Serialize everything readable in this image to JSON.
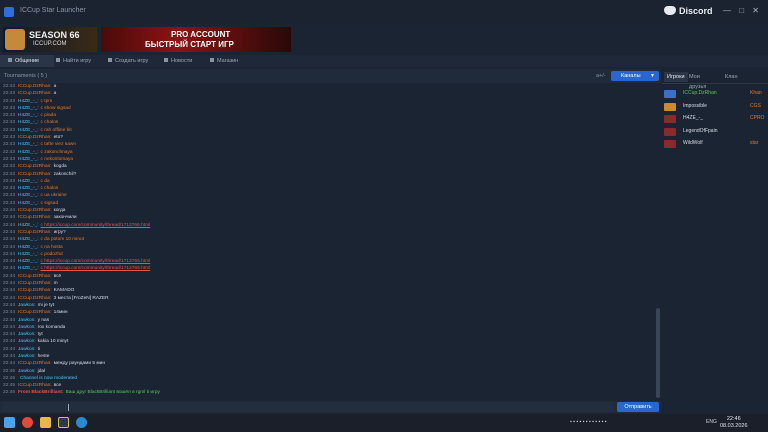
{
  "window": {
    "title": "ICCup Star Launcher",
    "controls": "— □ ✕"
  },
  "discord": {
    "label": "Discord",
    "controls": "— □ ✕"
  },
  "banners": {
    "left": {
      "title": "SEASON 66",
      "site": "ICCUP.COM"
    },
    "right": {
      "line1": "PRO ACCOUNT",
      "line2": "БЫСТРЫЙ СТАРТ ИГР"
    }
  },
  "tabs": [
    "Общение",
    "Найти игру",
    "Создать игру",
    "Новости",
    "Магазин"
  ],
  "chat_header": {
    "channel": "Tournaments ( 5 )",
    "font_toggle": "a+/-",
    "channels_button": "Каналы"
  },
  "messages": [
    {
      "time": "22:43",
      "user": "ICCup.DzRhan:",
      "ucls": "u-orange",
      "text": "a",
      "tcls": "m-white"
    },
    {
      "time": "22:43",
      "user": "ICCup.DzRhan:",
      "ucls": "u-orange",
      "text": "a",
      "tcls": "m-white"
    },
    {
      "time": "22:43",
      "user": "H4ZE_-_:",
      "ucls": "u-cyan",
      "text": "c tpm",
      "tcls": "m-orange"
    },
    {
      "time": "22:43",
      "user": "H4ZE_-_:",
      "ucls": "u-cyan",
      "text": "c show sigsad",
      "tcls": "m-orange"
    },
    {
      "time": "22:43",
      "user": "H4ZE_-_:",
      "ucls": "u-cyan",
      "text": "c piada",
      "tcls": "m-orange"
    },
    {
      "time": "22:43",
      "user": "H4ZE_-_:",
      "ucls": "u-cyan",
      "text": "c chalos",
      "tcls": "m-orange"
    },
    {
      "time": "22:43",
      "user": "H4ZE_-_:",
      "ucls": "u-cyan",
      "text": "c rah offline bit",
      "tcls": "m-orange"
    },
    {
      "time": "22:43",
      "user": "ICCup.DzRhan:",
      "ucls": "u-orange",
      "text": "eto?",
      "tcls": "m-white"
    },
    {
      "time": "22:43",
      "user": "H4ZE_-_:",
      "ucls": "u-cyan",
      "text": "c tafte viez sawn",
      "tcls": "m-orange"
    },
    {
      "time": "22:43",
      "user": "H4ZE_-_:",
      "ucls": "u-cyan",
      "text": "c zakonchnaya",
      "tcls": "m-orange"
    },
    {
      "time": "22:43",
      "user": "H4ZE_-_:",
      "ucls": "u-cyan",
      "text": "c nekontorsaya",
      "tcls": "m-orange"
    },
    {
      "time": "22:43",
      "user": "ICCup.DzRhan:",
      "ucls": "u-orange",
      "text": "kogda",
      "tcls": "m-white"
    },
    {
      "time": "22:43",
      "user": "ICCup.DzRhan:",
      "ucls": "u-orange",
      "text": "zakonchil?",
      "tcls": "m-white"
    },
    {
      "time": "22:43",
      "user": "H4ZE_-_:",
      "ucls": "u-cyan",
      "text": "c da",
      "tcls": "m-orange"
    },
    {
      "time": "22:43",
      "user": "H4ZE_-_:",
      "ucls": "u-cyan",
      "text": "c chalos",
      "tcls": "m-orange"
    },
    {
      "time": "22:43",
      "user": "H4ZE_-_:",
      "ucls": "u-cyan",
      "text": "c ua ukraine",
      "tcls": "m-orange"
    },
    {
      "time": "22:43",
      "user": "H4ZE_-_:",
      "ucls": "u-cyan",
      "text": "c sigsad",
      "tcls": "m-orange"
    },
    {
      "time": "22:44",
      "user": "ICCup.DzRhan:",
      "ucls": "u-orange",
      "text": "когда",
      "tcls": "m-white"
    },
    {
      "time": "22:44",
      "user": "ICCup.DzRhan:",
      "ucls": "u-orange",
      "text": "закончили",
      "tcls": "m-white"
    },
    {
      "time": "22:44",
      "user": "H4ZE_-_:",
      "ucls": "u-cyan",
      "text": "c https://iccup.com/community/thread/1713766.html",
      "tcls": "m-link"
    },
    {
      "time": "22:44",
      "user": "ICCup.DzRhan:",
      "ucls": "u-orange",
      "text": "игру?",
      "tcls": "m-white"
    },
    {
      "time": "22:44",
      "user": "H4ZE_-_:",
      "ucls": "u-cyan",
      "text": "c da potom 10 minut",
      "tcls": "m-orange"
    },
    {
      "time": "22:44",
      "user": "H4ZE_-_:",
      "ucls": "u-cyan",
      "text": "c na hosta",
      "tcls": "m-orange"
    },
    {
      "time": "22:44",
      "user": "H4ZE_-_:",
      "ucls": "u-cyan",
      "text": "c podozhd",
      "tcls": "m-orange"
    },
    {
      "time": "22:44",
      "user": "H4ZE_-_:",
      "ucls": "u-cyan",
      "text": "c https://iccup.com/community/thread/1713766.html",
      "tcls": "m-link"
    },
    {
      "time": "22:44",
      "user": "H4ZE_-_:",
      "ucls": "u-cyan",
      "text": "c https://iccup.com/community/thread/1713766.html",
      "tcls": "m-link"
    },
    {
      "time": "22:44",
      "user": "ICCup.DzRhan:",
      "ucls": "u-orange",
      "text": "всё",
      "tcls": "m-white"
    },
    {
      "time": "22:44",
      "user": "ICCup.DzRhan:",
      "ucls": "u-orange",
      "text": "m",
      "tcls": "m-white"
    },
    {
      "time": "22:44",
      "user": "ICCup.DzRhan:",
      "ucls": "u-orange",
      "text": "KAMADO",
      "tcls": "m-white"
    },
    {
      "time": "22:44",
      "user": "ICCup.DzRhan:",
      "ucls": "u-orange",
      "text": "3 места [FroZeN] RAZER",
      "tcls": "m-white"
    },
    {
      "time": "22:44",
      "user": "Jawkon:",
      "ucls": "u-cyan",
      "text": "mi je tyt",
      "tcls": "m-white"
    },
    {
      "time": "22:44",
      "user": "ICCup.DzRhan:",
      "ucls": "u-orange",
      "text": "14мин",
      "tcls": "m-white"
    },
    {
      "time": "22:44",
      "user": "Jawkon:",
      "ucls": "u-cyan",
      "text": "y nas",
      "tcls": "m-white"
    },
    {
      "time": "22:44",
      "user": "Jawkon:",
      "ucls": "u-cyan",
      "text": "rox komanda",
      "tcls": "m-white"
    },
    {
      "time": "22:44",
      "user": "Jawkon:",
      "ucls": "u-cyan",
      "text": "tyt",
      "tcls": "m-white"
    },
    {
      "time": "22:44",
      "user": "Jawkon:",
      "ucls": "u-cyan",
      "text": "kakia 10 minyt",
      "tcls": "m-white"
    },
    {
      "time": "22:44",
      "user": "Jawkon:",
      "ucls": "u-cyan",
      "text": "ti",
      "tcls": "m-white"
    },
    {
      "time": "22:44",
      "user": "Jawkon:",
      "ucls": "u-cyan",
      "text": "heste",
      "tcls": "m-white"
    },
    {
      "time": "22:44",
      "user": "ICCup.DzRhan:",
      "ucls": "u-orange",
      "text": "между раундами 5 мин",
      "tcls": "m-white"
    },
    {
      "time": "22:45",
      "user": "Jawkon:",
      "ucls": "u-cyan",
      "text": "jdal",
      "tcls": "m-white"
    },
    {
      "time": "22:45",
      "user": "",
      "ucls": "u-cyan",
      "text": "Channel is now moderated",
      "tcls": "m-cyan"
    },
    {
      "time": "22:45",
      "user": "ICCup.DzRhan:",
      "ucls": "u-orange",
      "text": "все",
      "tcls": "m-white"
    },
    {
      "time": "22:46",
      "user": "From BlackBrilliant:",
      "ucls": "u-red",
      "text": "Ваш друг BlackBrilliant вошёл в rgml ti игру",
      "tcls": "m-green"
    }
  ],
  "input": {
    "placeholder": "",
    "send_label": "Отправить"
  },
  "right_tabs": [
    "Игроки",
    "Мои друзья",
    "Клан"
  ],
  "players": [
    {
      "name": "ICCup.DzRhan",
      "rank": "Khan",
      "color": "#5cc85c",
      "pic": "#3a6ed0"
    },
    {
      "name": "Impossible",
      "rank": "CGS",
      "color": "#d8dde6",
      "pic": "#d08a2a"
    },
    {
      "name": "H4ZE_-_",
      "rank": "CPRO",
      "color": "#d8dde6",
      "pic": "#8a2a2a"
    },
    {
      "name": "LegendOfFpain",
      "rank": "",
      "color": "#d8dde6",
      "pic": "#8a2a2a"
    },
    {
      "name": "WildWolf",
      "rank": "star",
      "color": "#d8dde6",
      "pic": "#8a2a2a"
    }
  ],
  "taskbar": {
    "lang": "ENG",
    "time": "22:46",
    "date": "08.03.2026"
  }
}
